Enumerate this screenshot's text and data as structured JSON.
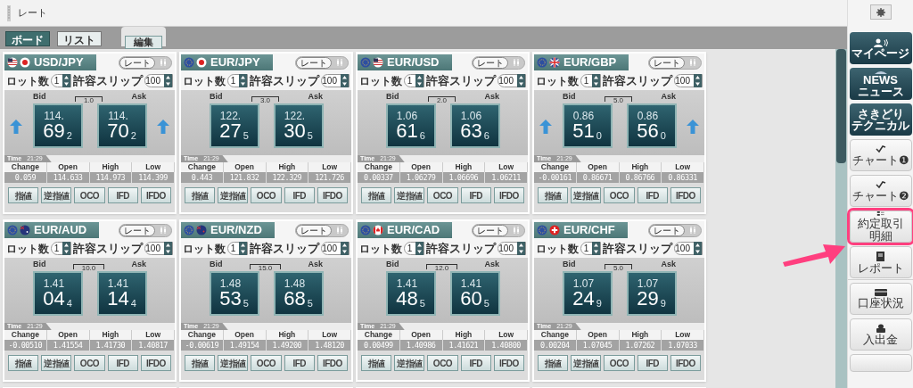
{
  "panel": {
    "title": "レート"
  },
  "tabs": [
    {
      "label": "ボード",
      "selected": true
    },
    {
      "label": "リスト",
      "selected": false
    }
  ],
  "edit_button": "編集",
  "cards": [
    {
      "pair": "USD/JPY",
      "mode": "レート",
      "lot_label": "ロット数",
      "lot": "1",
      "slip_label": "許容スリップ",
      "slip": "100",
      "bid_label": "Bid",
      "ask_label": "Ask",
      "spread": "1.0",
      "up_arrow": true,
      "bid": [
        "114.",
        "69",
        "2"
      ],
      "ask": [
        "114.",
        "70",
        "2"
      ],
      "time_label": "Time",
      "time": "21:29",
      "stats": [
        [
          "Change",
          "0.059"
        ],
        [
          "Open",
          "114.633"
        ],
        [
          "High",
          "114.973"
        ],
        [
          "Low",
          "114.399"
        ]
      ],
      "buttons": [
        "指値",
        "逆指値",
        "OCO",
        "IFD",
        "IFDO"
      ]
    },
    {
      "pair": "EUR/JPY",
      "mode": "レート",
      "lot_label": "ロット数",
      "lot": "1",
      "slip_label": "許容スリップ",
      "slip": "100",
      "bid_label": "Bid",
      "ask_label": "Ask",
      "spread": "3.0",
      "up_arrow": false,
      "bid": [
        "122.",
        "27",
        "5"
      ],
      "ask": [
        "122.",
        "30",
        "5"
      ],
      "time_label": "Time",
      "time": "21:29",
      "stats": [
        [
          "Change",
          "0.443"
        ],
        [
          "Open",
          "121.832"
        ],
        [
          "High",
          "122.329"
        ],
        [
          "Low",
          "121.726"
        ]
      ],
      "buttons": [
        "指値",
        "逆指値",
        "OCO",
        "IFD",
        "IFDO"
      ]
    },
    {
      "pair": "EUR/USD",
      "mode": "レート",
      "lot_label": "ロット数",
      "lot": "1",
      "slip_label": "許容スリップ",
      "slip": "100",
      "bid_label": "Bid",
      "ask_label": "Ask",
      "spread": "2.0",
      "up_arrow": false,
      "bid": [
        "1.06",
        "61",
        "6"
      ],
      "ask": [
        "1.06",
        "63",
        "6"
      ],
      "time_label": "Time",
      "time": "21:29",
      "stats": [
        [
          "Change",
          "0.00337"
        ],
        [
          "Open",
          "1.06279"
        ],
        [
          "High",
          "1.06696"
        ],
        [
          "Low",
          "1.06211"
        ]
      ],
      "buttons": [
        "指値",
        "逆指値",
        "OCO",
        "IFD",
        "IFDO"
      ]
    },
    {
      "pair": "EUR/GBP",
      "mode": "レート",
      "lot_label": "ロット数",
      "lot": "1",
      "slip_label": "許容スリップ",
      "slip": "100",
      "bid_label": "Bid",
      "ask_label": "Ask",
      "spread": "5.0",
      "up_arrow": true,
      "bid": [
        "0.86",
        "51",
        "0"
      ],
      "ask": [
        "0.86",
        "56",
        "0"
      ],
      "time_label": "Time",
      "time": "21:29",
      "stats": [
        [
          "Change",
          "-0.00161"
        ],
        [
          "Open",
          "0.86671"
        ],
        [
          "High",
          "0.86766"
        ],
        [
          "Low",
          "0.86331"
        ]
      ],
      "buttons": [
        "指値",
        "逆指値",
        "OCO",
        "IFD",
        "IFDO"
      ]
    },
    {
      "pair": "EUR/AUD",
      "mode": "レート",
      "lot_label": "ロット数",
      "lot": "1",
      "slip_label": "許容スリップ",
      "slip": "100",
      "bid_label": "Bid",
      "ask_label": "Ask",
      "spread": "10.0",
      "up_arrow": false,
      "bid": [
        "1.41",
        "04",
        "4"
      ],
      "ask": [
        "1.41",
        "14",
        "4"
      ],
      "time_label": "Time",
      "time": "21:29",
      "stats": [
        [
          "Change",
          "-0.00510"
        ],
        [
          "Open",
          "1.41554"
        ],
        [
          "High",
          "1.41730"
        ],
        [
          "Low",
          "1.40817"
        ]
      ],
      "buttons": [
        "指値",
        "逆指値",
        "OCO",
        "IFD",
        "IFDO"
      ]
    },
    {
      "pair": "EUR/NZD",
      "mode": "レート",
      "lot_label": "ロット数",
      "lot": "1",
      "slip_label": "許容スリップ",
      "slip": "100",
      "bid_label": "Bid",
      "ask_label": "Ask",
      "spread": "15.0",
      "up_arrow": false,
      "bid": [
        "1.48",
        "53",
        "5"
      ],
      "ask": [
        "1.48",
        "68",
        "5"
      ],
      "time_label": "Time",
      "time": "21:29",
      "stats": [
        [
          "Change",
          "-0.00619"
        ],
        [
          "Open",
          "1.49154"
        ],
        [
          "High",
          "1.49200"
        ],
        [
          "Low",
          "1.48120"
        ]
      ],
      "buttons": [
        "指値",
        "逆指値",
        "OCO",
        "IFD",
        "IFDO"
      ]
    },
    {
      "pair": "EUR/CAD",
      "mode": "レート",
      "lot_label": "ロット数",
      "lot": "1",
      "slip_label": "許容スリップ",
      "slip": "100",
      "bid_label": "Bid",
      "ask_label": "Ask",
      "spread": "12.0",
      "up_arrow": false,
      "bid": [
        "1.41",
        "48",
        "5"
      ],
      "ask": [
        "1.41",
        "60",
        "5"
      ],
      "time_label": "Time",
      "time": "21:29",
      "stats": [
        [
          "Change",
          "0.00499"
        ],
        [
          "Open",
          "1.40986"
        ],
        [
          "High",
          "1.41621"
        ],
        [
          "Low",
          "1.40800"
        ]
      ],
      "buttons": [
        "指値",
        "逆指値",
        "OCO",
        "IFD",
        "IFDO"
      ]
    },
    {
      "pair": "EUR/CHF",
      "mode": "レート",
      "lot_label": "ロット数",
      "lot": "1",
      "slip_label": "許容スリップ",
      "slip": "100",
      "bid_label": "Bid",
      "ask_label": "Ask",
      "spread": "5.0",
      "up_arrow": false,
      "bid": [
        "1.07",
        "24",
        "9"
      ],
      "ask": [
        "1.07",
        "29",
        "9"
      ],
      "time_label": "Time",
      "time": "21:29",
      "stats": [
        [
          "Change",
          "0.00204"
        ],
        [
          "Open",
          "1.07045"
        ],
        [
          "High",
          "1.07262"
        ],
        [
          "Low",
          "1.07033"
        ]
      ],
      "buttons": [
        "指値",
        "逆指値",
        "OCO",
        "IFD",
        "IFDO"
      ]
    }
  ],
  "sidebar": {
    "items": [
      {
        "kind": "dark",
        "lines": [
          "マイページ"
        ],
        "highlighted": false
      },
      {
        "kind": "dark",
        "lines": [
          "NEWS",
          "ニュース"
        ],
        "highlighted": false
      },
      {
        "kind": "dark",
        "lines": [
          "さきどり",
          "テクニカル"
        ],
        "highlighted": false
      },
      {
        "kind": "light",
        "lines": [
          "チャート❶"
        ],
        "highlighted": false
      },
      {
        "kind": "light",
        "lines": [
          "チャート❷"
        ],
        "highlighted": false
      },
      {
        "kind": "light",
        "lines": [
          "約定取引",
          "明細"
        ],
        "highlighted": true
      },
      {
        "kind": "light",
        "lines": [
          "レポート"
        ],
        "highlighted": false
      },
      {
        "kind": "light",
        "lines": [
          "口座状況"
        ],
        "highlighted": false
      },
      {
        "kind": "light",
        "lines": [
          "入出金"
        ],
        "highlighted": false
      }
    ]
  }
}
